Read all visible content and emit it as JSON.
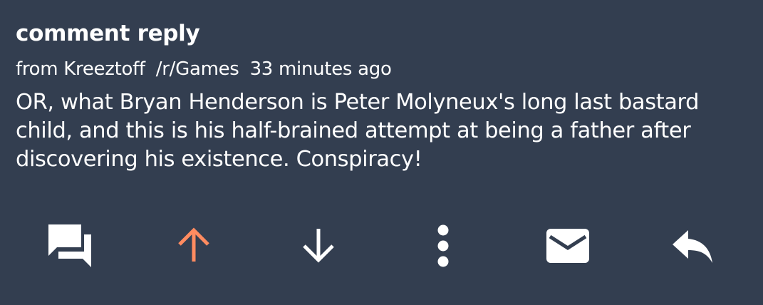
{
  "notification": {
    "title": "comment reply",
    "from_label": "from Kreeztoff",
    "subreddit": "/r/Games",
    "time": "33 minutes ago",
    "body": "OR, what Bryan Henderson is Peter Molyneux's long last bastard child, and this is his half-brained attempt at being a father after discovering his existence. Conspiracy!"
  },
  "actions": [
    {
      "name": "comments",
      "icon": "comments-icon"
    },
    {
      "name": "upvote",
      "icon": "arrow-up-icon",
      "color": "#ff8b60"
    },
    {
      "name": "downvote",
      "icon": "arrow-down-icon"
    },
    {
      "name": "more",
      "icon": "more-vert-icon"
    },
    {
      "name": "message",
      "icon": "mail-icon"
    },
    {
      "name": "reply",
      "icon": "reply-icon"
    }
  ],
  "colors": {
    "background": "#333e50",
    "text": "#ffffff",
    "upvote_accent": "#ff8b60"
  }
}
